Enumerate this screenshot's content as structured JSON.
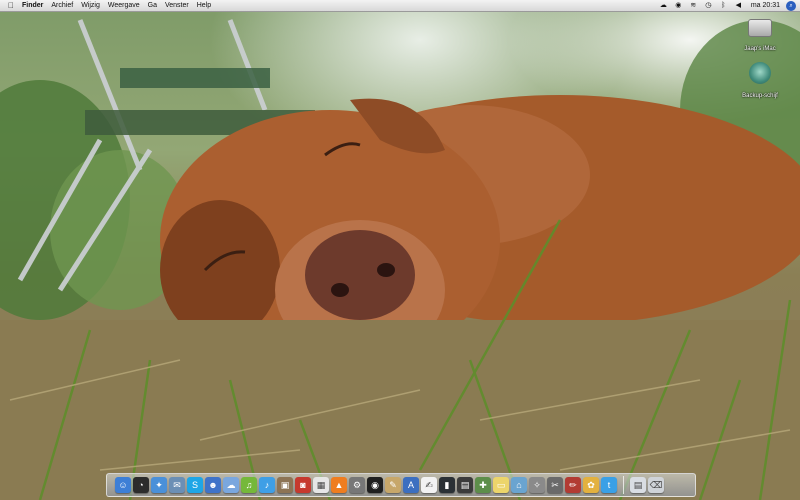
{
  "menubar": {
    "apple_icon": "apple-icon",
    "items": [
      "Finder",
      "Archief",
      "Wijzig",
      "Weergave",
      "Ga",
      "Venster",
      "Help"
    ],
    "status_icons": [
      "cloud-icon",
      "eye-icon",
      "wifi-icon",
      "clock-icon",
      "bluetooth-icon",
      "volume-icon"
    ],
    "clock": "ma 20:31",
    "spotlight_icon": "search-icon"
  },
  "desktop": {
    "icons": [
      {
        "label": "Jaap's iMac",
        "icon": "hard-drive-icon"
      },
      {
        "label": "Backup-schijf",
        "icon": "time-machine-icon"
      }
    ]
  },
  "dock": {
    "apps": [
      {
        "icon": "finder-icon",
        "color": "#3d7fd6",
        "glyph": "☺"
      },
      {
        "icon": "dashboard-icon",
        "color": "#2c2c2c",
        "glyph": "◔"
      },
      {
        "icon": "safari-icon",
        "color": "#4a90d9",
        "glyph": "✦"
      },
      {
        "icon": "mail-icon",
        "color": "#6b8fb5",
        "glyph": "✉"
      },
      {
        "icon": "skype-icon",
        "color": "#1ea6e6",
        "glyph": "S"
      },
      {
        "icon": "contacts-icon",
        "color": "#3f73c9",
        "glyph": "☻"
      },
      {
        "icon": "messages-icon",
        "color": "#7aa7de",
        "glyph": "☁"
      },
      {
        "icon": "spotify-icon",
        "color": "#75b83a",
        "glyph": "♫"
      },
      {
        "icon": "itunes-icon",
        "color": "#3f9fe6",
        "glyph": "♪"
      },
      {
        "icon": "iphoto-icon",
        "color": "#8d7455",
        "glyph": "▣"
      },
      {
        "icon": "photo-booth-icon",
        "color": "#c6392e",
        "glyph": "◙"
      },
      {
        "icon": "calendar-icon",
        "color": "#e6e6e6",
        "glyph": "▦"
      },
      {
        "icon": "vlc-icon",
        "color": "#ef7d20",
        "glyph": "▲"
      },
      {
        "icon": "system-preferences-icon",
        "color": "#777777",
        "glyph": "⚙"
      },
      {
        "icon": "aperture-icon",
        "color": "#1f1f1f",
        "glyph": "◉"
      },
      {
        "icon": "preview-icon",
        "color": "#c7a76a",
        "glyph": "✎"
      },
      {
        "icon": "app-store-icon",
        "color": "#3c6fc0",
        "glyph": "A"
      },
      {
        "icon": "textedit-icon",
        "color": "#f2f2f2",
        "glyph": "✍"
      },
      {
        "icon": "terminal-icon",
        "color": "#2a3035",
        "glyph": "▮"
      },
      {
        "icon": "activity-monitor-icon",
        "color": "#3b3b3b",
        "glyph": "▤"
      },
      {
        "icon": "network-icon",
        "color": "#5d8e4a",
        "glyph": "✚"
      },
      {
        "icon": "notes-icon",
        "color": "#ecd56b",
        "glyph": "▭"
      },
      {
        "icon": "maps-icon",
        "color": "#6aa4d0",
        "glyph": "⌂"
      },
      {
        "icon": "gear-icon",
        "color": "#8a8a8a",
        "glyph": "✧"
      },
      {
        "icon": "utility-icon",
        "color": "#6a6a6a",
        "glyph": "✂"
      },
      {
        "icon": "script-editor-icon",
        "color": "#b23b33",
        "glyph": "✏"
      },
      {
        "icon": "photos-icon",
        "color": "#e3b13f",
        "glyph": "✿"
      },
      {
        "icon": "twitter-icon",
        "color": "#3aa0e6",
        "glyph": "t"
      }
    ],
    "trailing": [
      {
        "icon": "downloads-stack-icon",
        "color": "#d9dde3",
        "glyph": "▤"
      },
      {
        "icon": "trash-icon",
        "color": "#cfd3d8",
        "glyph": "⌫"
      }
    ]
  },
  "colors": {
    "grass": "#8b7d57",
    "dog": "#a45a2d",
    "foliage": "#7e9b68",
    "menubar": "#e6e6e6"
  }
}
